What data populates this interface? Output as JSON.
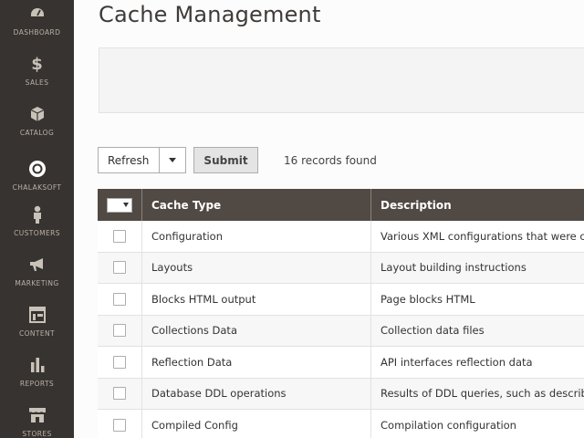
{
  "sidebar": {
    "items": [
      {
        "label": "DASHBOARD",
        "icon": "dashboard-icon"
      },
      {
        "label": "SALES",
        "icon": "dollar-icon"
      },
      {
        "label": "CATALOG",
        "icon": "box-icon"
      },
      {
        "label": "CHALAKSOFT",
        "icon": "ring-icon"
      },
      {
        "label": "CUSTOMERS",
        "icon": "person-icon"
      },
      {
        "label": "MARKETING",
        "icon": "megaphone-icon"
      },
      {
        "label": "CONTENT",
        "icon": "layout-icon"
      },
      {
        "label": "REPORTS",
        "icon": "bar-chart-icon"
      },
      {
        "label": "STORES",
        "icon": "storefront-icon"
      }
    ]
  },
  "page": {
    "title": "Cache Management"
  },
  "toolbar": {
    "action_value": "Refresh",
    "submit_label": "Submit",
    "records_text": "16 records found"
  },
  "grid": {
    "columns": [
      "Cache Type",
      "Description"
    ],
    "rows": [
      {
        "type": "Configuration",
        "description": "Various XML configurations that were coll"
      },
      {
        "type": "Layouts",
        "description": "Layout building instructions"
      },
      {
        "type": "Blocks HTML output",
        "description": "Page blocks HTML"
      },
      {
        "type": "Collections Data",
        "description": "Collection data files"
      },
      {
        "type": "Reflection Data",
        "description": "API interfaces reflection data"
      },
      {
        "type": "Database DDL operations",
        "description": "Results of DDL queries, such as describing"
      },
      {
        "type": "Compiled Config",
        "description": "Compilation configuration"
      }
    ]
  },
  "colors": {
    "sidebar_bg": "#373330",
    "grid_header_bg": "#514943"
  }
}
